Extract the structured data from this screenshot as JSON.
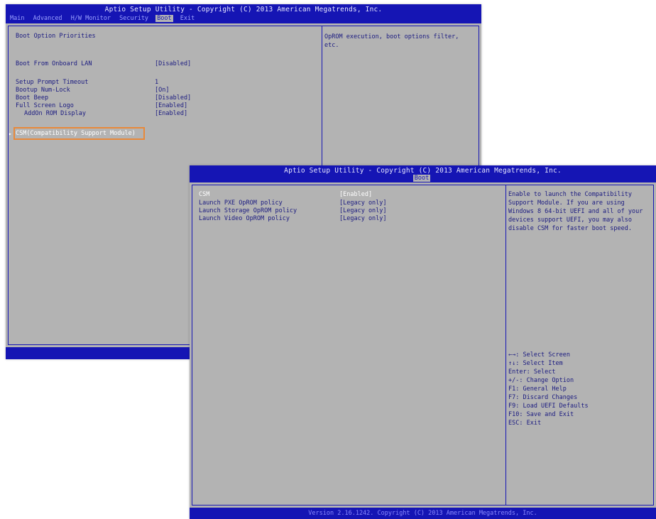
{
  "win1": {
    "title": "Aptio Setup Utility - Copyright (C) 2013 American Megatrends, Inc.",
    "tabs": [
      "Main",
      "Advanced",
      "H/W Monitor",
      "Security",
      "Boot",
      "Exit"
    ],
    "active_tab": 4,
    "section_title": "Boot Option Priorities",
    "items": [
      {
        "label": "Boot From Onboard LAN",
        "value": "[Disabled]"
      },
      {
        "label": "Setup Prompt Timeout",
        "value": "1"
      },
      {
        "label": "Bootup Num-Lock",
        "value": "[On]"
      },
      {
        "label": "Boot Beep",
        "value": "[Disabled]"
      },
      {
        "label": "Full Screen Logo",
        "value": "[Enabled]"
      },
      {
        "label": "AddOn ROM Display",
        "value": "[Enabled]"
      }
    ],
    "submenu": "CSM(Compatibility Support Module)",
    "help_text": [
      "OpROM execution, boot options filter,",
      "etc."
    ],
    "footer": "Version 2.16.1242"
  },
  "win2": {
    "title": "Aptio Setup Utility - Copyright (C) 2013 American Megatrends, Inc.",
    "tab": "Boot",
    "items": [
      {
        "label": "CSM",
        "value": "[Enabled]"
      },
      {
        "label": "Launch PXE OpROM policy",
        "value": "[Legacy only]"
      },
      {
        "label": "Launch Storage OpROM policy",
        "value": "[Legacy only]"
      },
      {
        "label": "Launch Video OpROM policy",
        "value": "[Legacy only]"
      }
    ],
    "help_text": [
      "Enable to launch the Compatibility",
      "Support Module. If you are using",
      "Windows 8 64-bit UEFI and all of your",
      "devices support UEFI, you may also",
      "disable CSM for faster boot speed."
    ],
    "keys": [
      "←→: Select Screen",
      "↑↓: Select Item",
      "Enter: Select",
      "+/-: Change Option",
      "F1: General Help",
      "F7: Discard Changes",
      "F9: Load UEFI Defaults",
      "F10: Save and Exit",
      "ESC: Exit"
    ],
    "footer": "Version 2.16.1242. Copyright (C) 2013 American Megatrends, Inc."
  }
}
